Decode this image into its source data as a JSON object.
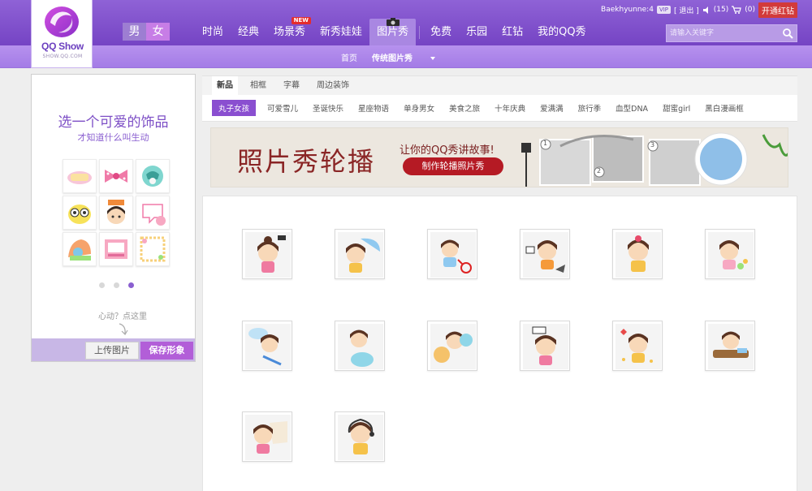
{
  "brand": {
    "logo_text": "QQ Show",
    "logo_sub": "SHOW.QQ.COM"
  },
  "gender": {
    "male": "男",
    "female": "女"
  },
  "nav": {
    "items": [
      {
        "label": "时尚",
        "badge": ""
      },
      {
        "label": "经典",
        "badge": ""
      },
      {
        "label": "场景秀",
        "badge": "NEW"
      },
      {
        "label": "新秀娃娃",
        "badge": ""
      },
      {
        "label": "图片秀",
        "badge": ""
      },
      {
        "label": "免费",
        "badge": ""
      },
      {
        "label": "乐园",
        "badge": ""
      },
      {
        "label": "红钻",
        "badge": ""
      },
      {
        "label": "我的QQ秀",
        "badge": ""
      }
    ]
  },
  "user": {
    "username": "Baekhyunne:4",
    "vip_label": "VIP",
    "logout": "[ 退出 ]",
    "messages": "(15)",
    "cart": "(0)",
    "open_vip": "开通红钻"
  },
  "search": {
    "placeholder": "请输入关键字"
  },
  "subnav": {
    "home": "首页",
    "current": "传统图片秀"
  },
  "left_panel": {
    "title": "选一个可爱的饰品",
    "subtitle": "才知道什么叫生动",
    "hint": "心动？点这里",
    "upload": "上传图片",
    "save": "保存形象",
    "carousel_active": 3
  },
  "tabs": [
    "新品",
    "相框",
    "字幕",
    "周边装饰"
  ],
  "categories": [
    "丸子女孩",
    "可爱雪儿",
    "圣诞快乐",
    "星座物语",
    "单身男女",
    "美食之旅",
    "十年庆典",
    "爱满满",
    "旅行季",
    "血型DNA",
    "甜蜜girl",
    "黑白漫画框"
  ],
  "banner": {
    "title": "照片秀轮播",
    "subtitle": "让你的QQ秀讲故事!",
    "button": "制作轮播照片秀",
    "steps": [
      "1",
      "2",
      "3"
    ]
  },
  "colors": {
    "brand_purple": "#7f50cc",
    "accent": "#b25ed8",
    "banner_red": "#b51a24"
  }
}
